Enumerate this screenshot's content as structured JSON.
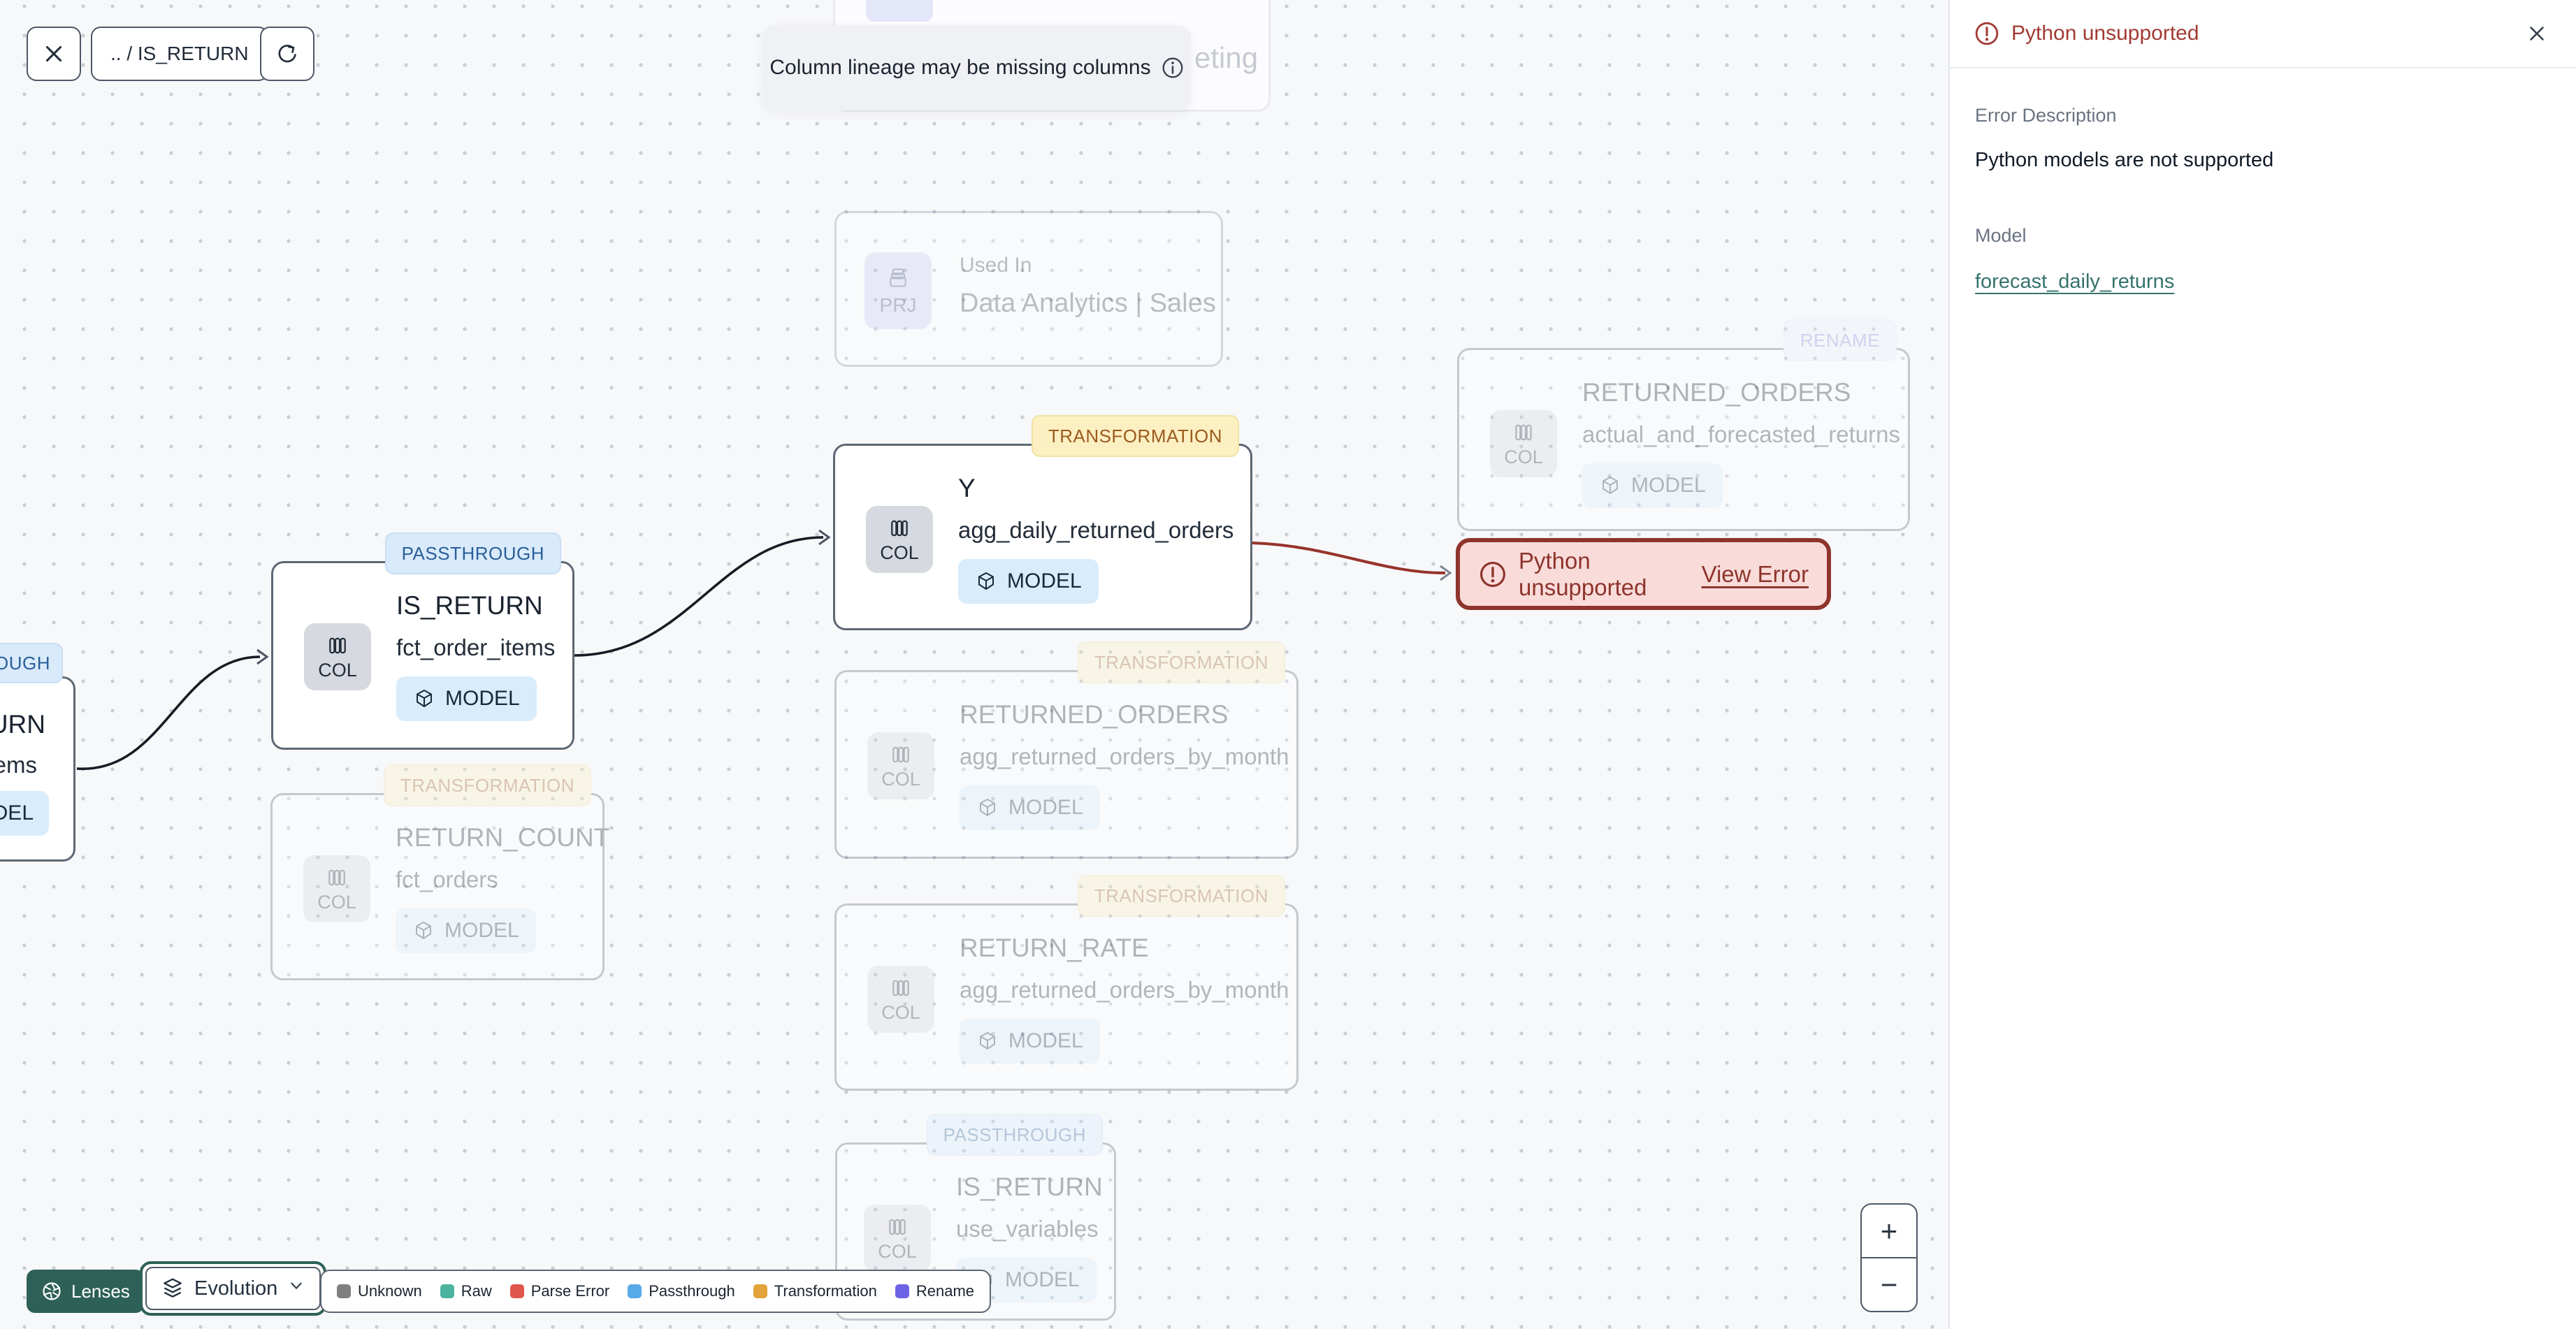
{
  "toolbar": {
    "breadcrumb": ".. / IS_RETURN"
  },
  "banner": {
    "text": "Column lineage may be missing columns"
  },
  "canvas": {
    "nodes": {
      "top_used_in": {
        "fragment": "eting"
      },
      "left_partial": {
        "badge_fragment": "OUGH",
        "title_fragment": "URN",
        "subtitle_fragment": "ems",
        "chip_fragment": "DEL"
      },
      "fct_order_items": {
        "badge": "PASSTHROUGH",
        "col_label": "COL",
        "title": "IS_RETURN",
        "subtitle": "fct_order_items",
        "chip": "MODEL"
      },
      "agg_daily_returned_orders": {
        "badge": "TRANSFORMATION",
        "col_label": "COL",
        "title": "Y",
        "subtitle": "agg_daily_returned_orders",
        "chip": "MODEL"
      },
      "used_in_sales": {
        "prj_label": "PRJ",
        "title": "Used In",
        "subtitle": "Data Analytics | Sales"
      },
      "actual_and_forecasted_returns": {
        "badge": "RENAME",
        "col_label": "COL",
        "title": "RETURNED_ORDERS",
        "subtitle": "actual_and_forecasted_returns",
        "chip": "MODEL"
      },
      "agg_returned_orders_by_month": {
        "badge": "TRANSFORMATION",
        "col_label": "COL",
        "title": "RETURNED_ORDERS",
        "subtitle": "agg_returned_orders_by_month",
        "chip": "MODEL"
      },
      "return_rate": {
        "badge": "TRANSFORMATION",
        "col_label": "COL",
        "title": "RETURN_RATE",
        "subtitle": "agg_returned_orders_by_month",
        "chip": "MODEL"
      },
      "return_count": {
        "badge": "TRANSFORMATION",
        "col_label": "COL",
        "title": "RETURN_COUNT",
        "subtitle": "fct_orders",
        "chip": "MODEL"
      },
      "use_variables": {
        "badge": "PASSTHROUGH",
        "col_label": "COL",
        "title": "IS_RETURN",
        "subtitle": "use_variables",
        "chip": "MODEL"
      }
    },
    "error_node": {
      "text": "Python unsupported",
      "link": "View Error"
    }
  },
  "panel": {
    "title": "Python unsupported",
    "error_description_label": "Error Description",
    "error_description_value": "Python models are not supported",
    "model_label": "Model",
    "model_link": "forecast_daily_returns"
  },
  "footer": {
    "lenses_label": "Lenses",
    "lens_value": "Evolution",
    "legend": {
      "items": [
        {
          "label": "Unknown",
          "color": "#7f7f7f"
        },
        {
          "label": "Raw",
          "color": "#4cb39e"
        },
        {
          "label": "Parse Error",
          "color": "#e0564b"
        },
        {
          "label": "Passthrough",
          "color": "#57a9e8"
        },
        {
          "label": "Transformation",
          "color": "#e2a33b"
        },
        {
          "label": "Rename",
          "color": "#6e62e5"
        }
      ]
    }
  },
  "zoom_controls": {
    "zoom_in": "+",
    "zoom_out": "−"
  },
  "colors": {
    "accent_teal": "#2d6157",
    "error_red": "#8e342c",
    "edge_black": "#161c24",
    "link_teal": "#35736c",
    "badge_passthrough": "#d9eafb",
    "badge_transformation": "#fcf0c2",
    "badge_rename": "#eef0fc"
  }
}
